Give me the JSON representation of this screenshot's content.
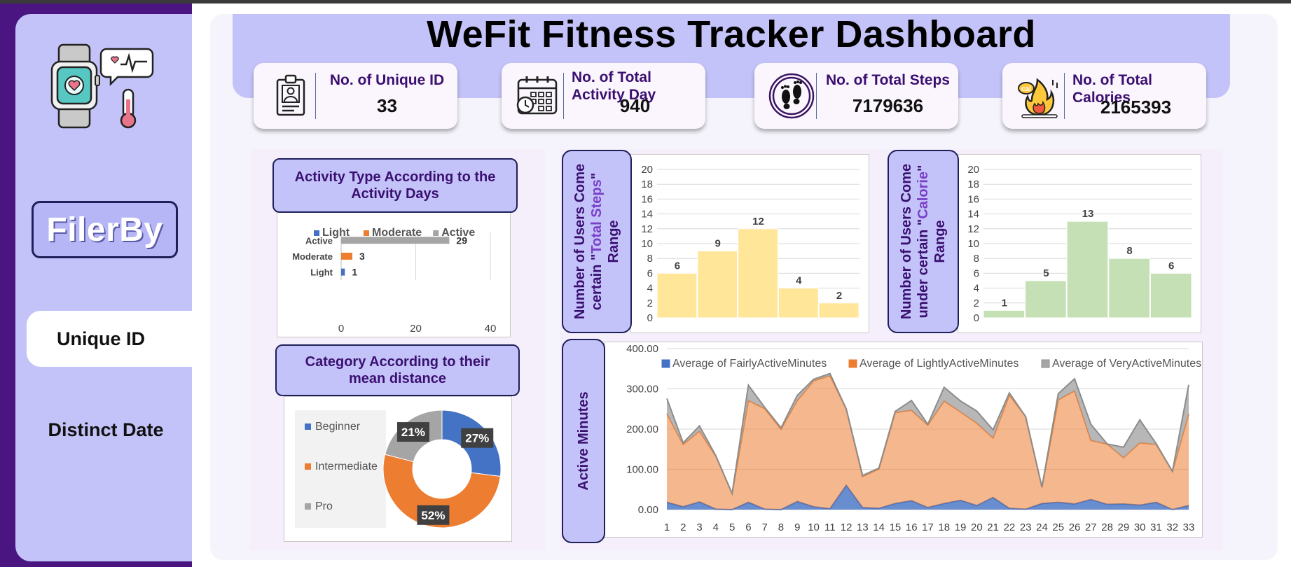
{
  "dashboard": {
    "title": "WeFit Fitness Tracker Dashboard"
  },
  "sidebar": {
    "filter_label": "FilerBy",
    "items": [
      {
        "label": "Unique ID",
        "active": true
      },
      {
        "label": "Distinct Date",
        "active": false
      }
    ]
  },
  "kpis": [
    {
      "label": "No. of Unique ID",
      "value": "33",
      "icon": "id-badge-icon"
    },
    {
      "label": "No. of Total Activity Day",
      "value": "940",
      "icon": "calendar-icon"
    },
    {
      "label": "No. of Total Steps",
      "value": "7179636",
      "icon": "footprints-icon"
    },
    {
      "label": "No. of Total Calories",
      "value": "2165393",
      "icon": "calorie-fire-icon"
    }
  ],
  "panels": {
    "activity_title": "Activity Type According to the Activity Days",
    "distance_title": "Category According to their mean distance",
    "steps_axis_label": [
      "Number of Users Come",
      "certain \"",
      "Total Steps",
      "\"",
      "Range"
    ],
    "calorie_axis_label": [
      "Number of Users Come",
      "under certain \"",
      "Calorie",
      "\"",
      "Range"
    ],
    "minutes_axis_label": "Active Minutes"
  },
  "colors": {
    "blue": "#4472c4",
    "orange": "#ed7d31",
    "gray": "#a5a5a5",
    "yellow": "#ffe699",
    "green": "#c5e0b4",
    "accent": "#c3c3f9",
    "dark_purple": "#3a0f70"
  },
  "chart_data": [
    {
      "id": "activity",
      "type": "bar",
      "orientation": "horizontal",
      "categories": [
        "Light",
        "Moderate",
        "Active"
      ],
      "values": [
        1,
        3,
        29
      ],
      "colors": [
        "#4472c4",
        "#ed7d31",
        "#a5a5a5"
      ],
      "legend": [
        "Light",
        "Moderate",
        "Active"
      ],
      "legend_position": "top",
      "xlim": [
        0,
        40
      ],
      "xticks": [
        0,
        20,
        40
      ],
      "data_labels": true,
      "grid": true
    },
    {
      "id": "distance",
      "type": "pie",
      "style": "doughnut",
      "labels": [
        "Beginner",
        "Intermediate",
        "Pro"
      ],
      "values": [
        27,
        52,
        21
      ],
      "display": [
        "27%",
        "52%",
        "21%"
      ],
      "colors": [
        "#4472c4",
        "#ed7d31",
        "#a5a5a5"
      ],
      "legend_position": "left"
    },
    {
      "id": "steps",
      "type": "bar",
      "values": [
        6,
        9,
        12,
        4,
        2
      ],
      "ylim": [
        0,
        20
      ],
      "yticks": [
        0,
        2,
        4,
        6,
        8,
        10,
        12,
        14,
        16,
        18,
        20
      ],
      "color": "#ffe699",
      "data_labels": true,
      "grid": true
    },
    {
      "id": "calories",
      "type": "bar",
      "values": [
        1,
        5,
        13,
        8,
        6
      ],
      "ylim": [
        0,
        20
      ],
      "yticks": [
        0,
        2,
        4,
        6,
        8,
        10,
        12,
        14,
        16,
        18,
        20
      ],
      "color": "#c5e0b4",
      "data_labels": true,
      "grid": true
    },
    {
      "id": "minutes",
      "type": "area",
      "stacked": true,
      "x": [
        1,
        2,
        3,
        4,
        5,
        6,
        7,
        8,
        9,
        10,
        11,
        12,
        13,
        14,
        15,
        16,
        17,
        18,
        19,
        20,
        21,
        22,
        23,
        24,
        25,
        26,
        27,
        28,
        29,
        30,
        31,
        32,
        33
      ],
      "ylim": [
        0,
        400
      ],
      "yticks": [
        "0.00",
        "100.00",
        "200.00",
        "300.00",
        "400.00"
      ],
      "legend_position": "top",
      "grid": true,
      "series": [
        {
          "name": "Average of FairlyActiveMinutes",
          "color": "#4472c4",
          "values": [
            18,
            7,
            19,
            1,
            0,
            18,
            1,
            0,
            20,
            7,
            2,
            60,
            5,
            3,
            15,
            22,
            5,
            15,
            23,
            10,
            30,
            3,
            1,
            15,
            18,
            14,
            25,
            13,
            14,
            11,
            18,
            0,
            10
          ]
        },
        {
          "name": "Average of LightlyActiveMinutes",
          "color": "#ed7d31",
          "values": [
            220,
            155,
            176,
            132,
            40,
            253,
            250,
            200,
            251,
            313,
            331,
            190,
            77,
            98,
            226,
            225,
            205,
            255,
            220,
            205,
            148,
            282,
            230,
            40,
            255,
            281,
            147,
            150,
            115,
            155,
            144,
            95,
            228
          ]
        },
        {
          "name": "Average of VeryActiveMinutes",
          "color": "#a5a5a5",
          "values": [
            38,
            4,
            13,
            1,
            0,
            38,
            3,
            3,
            13,
            4,
            5,
            0,
            3,
            2,
            3,
            24,
            2,
            34,
            27,
            30,
            20,
            5,
            0,
            1,
            15,
            30,
            40,
            0,
            26,
            57,
            2,
            0,
            72
          ]
        }
      ]
    }
  ]
}
